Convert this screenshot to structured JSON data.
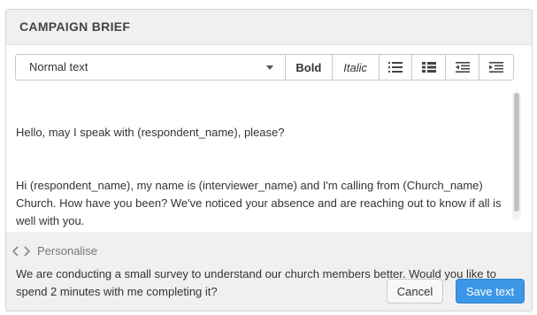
{
  "panel": {
    "title": "CAMPAIGN BRIEF"
  },
  "toolbar": {
    "format_select": "Normal text",
    "bold_label": "Bold",
    "italic_label": "Italic",
    "icons": [
      "ordered-list-icon",
      "unordered-list-icon",
      "outdent-icon",
      "indent-icon"
    ]
  },
  "editor": {
    "lines": [
      "Hello, may I speak with (respondent_name), please?",
      "Hi (respondent_name), my name is (interviewer_name) and I'm calling from (Church_name) Church. How have you been? We've noticed your absence and are reaching out to know if all is well with you.",
      "We are conducting a small survey to understand our church members better. Would you like to spend 2 minutes with me completing it?"
    ]
  },
  "personalise": {
    "label": "Personalise",
    "icon": "code-icon"
  },
  "actions": {
    "cancel_label": "Cancel",
    "save_label": "Save text"
  },
  "colors": {
    "primary": "#3c97e6",
    "panel_bg": "#f0f0f0"
  }
}
